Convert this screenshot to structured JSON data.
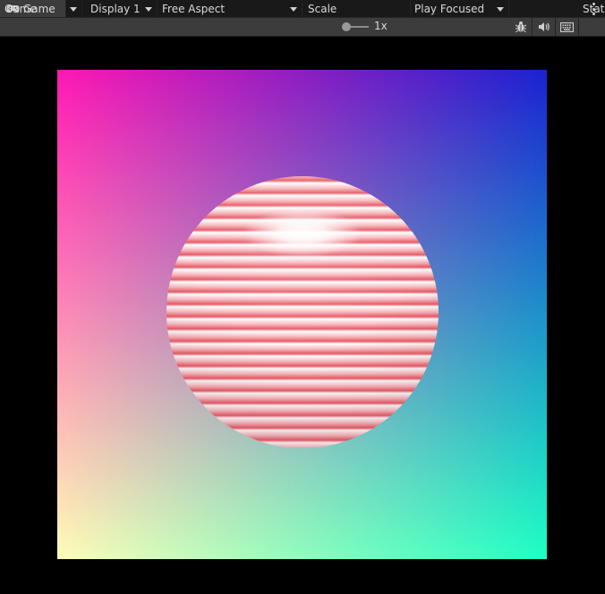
{
  "window": {
    "tab_label": "Game",
    "tab_icon": "gamepad-icon",
    "menu_icon": "kebab-menu-icon"
  },
  "toolbar": {
    "view_select": "Game",
    "display_select": "Display 1",
    "aspect_select": "Free Aspect",
    "scale_label": "Scale",
    "scale_value": "1x",
    "scale_slider_level": 0.0,
    "play_mode_select": "Play Focused",
    "stats_label": "Stat",
    "icons": [
      "bug-icon",
      "speaker-icon",
      "keyboard-icon"
    ]
  },
  "game_view": {
    "background_gradient": {
      "top_left": "#ff18b4",
      "top_right": "#1b22d0",
      "bottom_left": "#fffcb8",
      "bottom_right": "#1effc4"
    },
    "sphere_colors": {
      "base": "#f6b3b8",
      "stripe": "#e85a66",
      "highlight": "#ffffff"
    }
  }
}
